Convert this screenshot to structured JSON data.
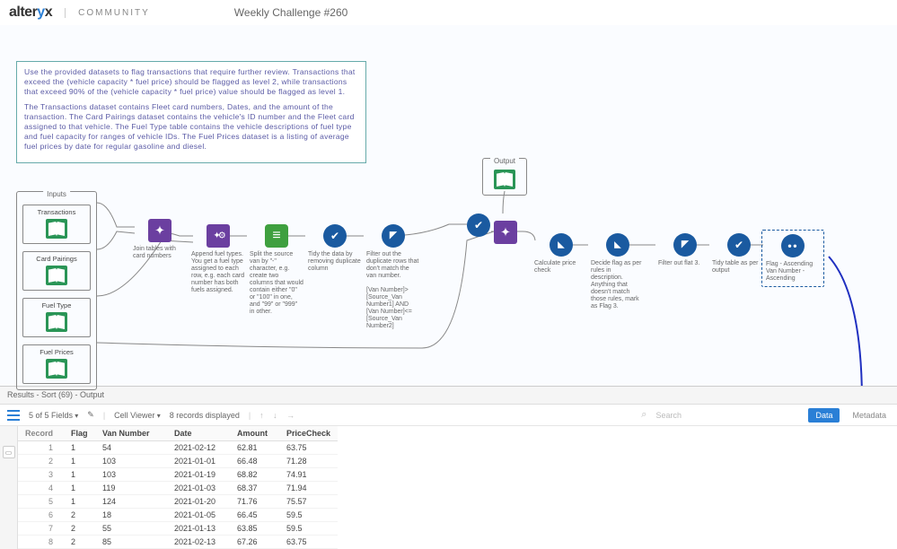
{
  "header": {
    "brand_pre": "alter",
    "brand_post": "x",
    "community": "COMMUNITY",
    "title": "Weekly Challenge #260"
  },
  "instructions": {
    "p1": "Use the provided datasets to flag transactions that require further review. Transactions that exceed the (vehicle capacity * fuel price) should be flagged as level 2, while transactions that exceed 90% of the (vehicle capacity * fuel price) value should be flagged as level 1.",
    "p2": "The Transactions dataset contains Fleet card numbers, Dates, and the amount of the transaction. The Card Pairings dataset contains the vehicle's ID number and the Fleet card assigned to that vehicle. The Fuel Type table contains the vehicle descriptions of fuel type and fuel capacity for ranges of vehicle IDs. The Fuel Prices dataset is a listing of average fuel prices by date for regular gasoline and diesel."
  },
  "inputs": {
    "group_label": "Inputs",
    "items": [
      "Transactions",
      "Card Pairings",
      "Fuel Type",
      "Fuel Prices"
    ]
  },
  "output": {
    "group_label": "Output"
  },
  "tools": {
    "join1": "Join tables with card numbers",
    "append": "Append fuel types. You get a fuel type assigned to each row, e.g. each card number has both fuels assigned.",
    "split": "Split the source van by \"-\" character, e.g. create two columns that would contain either \"0\" or \"100\" in one, and \"99\" or \"999\" in other.",
    "select1": "Tidy the data by removing duplicate column",
    "filter1": "Filter out the duplicate rows that don't match the van number.\n\n[Van Number]>[Source_Van Number1] AND [Van Number]<=[Source_Van Number2]",
    "formula1": "Calculate price check",
    "formula2": "Decide flag as per rules in description. Anything that doesn't match those rules, mark as Flag 3.",
    "filter2": "Filter out flat 3.",
    "select2": "Tidy table as per output",
    "sort": "Flag - Ascending\nVan Number - Ascending"
  },
  "results": {
    "title": "Results - Sort (69) - Output",
    "fields_summary": "5 of 5 Fields",
    "cell_viewer": "Cell Viewer",
    "records_summary": "8 records displayed",
    "search_placeholder": "Search",
    "btn_data": "Data",
    "btn_meta": "Metadata",
    "columns": [
      "Record",
      "Flag",
      "Van Number",
      "Date",
      "Amount",
      "PriceCheck"
    ],
    "rows": [
      {
        "rec": "1",
        "flag": "1",
        "van": "54",
        "date": "2021-02-12",
        "amt": "62.81",
        "pc": "63.75"
      },
      {
        "rec": "2",
        "flag": "1",
        "van": "103",
        "date": "2021-01-01",
        "amt": "66.48",
        "pc": "71.28"
      },
      {
        "rec": "3",
        "flag": "1",
        "van": "103",
        "date": "2021-01-19",
        "amt": "68.82",
        "pc": "74.91"
      },
      {
        "rec": "4",
        "flag": "1",
        "van": "119",
        "date": "2021-01-03",
        "amt": "68.37",
        "pc": "71.94"
      },
      {
        "rec": "5",
        "flag": "1",
        "van": "124",
        "date": "2021-01-20",
        "amt": "71.76",
        "pc": "75.57"
      },
      {
        "rec": "6",
        "flag": "2",
        "van": "18",
        "date": "2021-01-05",
        "amt": "66.45",
        "pc": "59.5"
      },
      {
        "rec": "7",
        "flag": "2",
        "van": "55",
        "date": "2021-01-13",
        "amt": "63.85",
        "pc": "59.5"
      },
      {
        "rec": "8",
        "flag": "2",
        "van": "85",
        "date": "2021-02-13",
        "amt": "67.26",
        "pc": "63.75"
      }
    ]
  }
}
